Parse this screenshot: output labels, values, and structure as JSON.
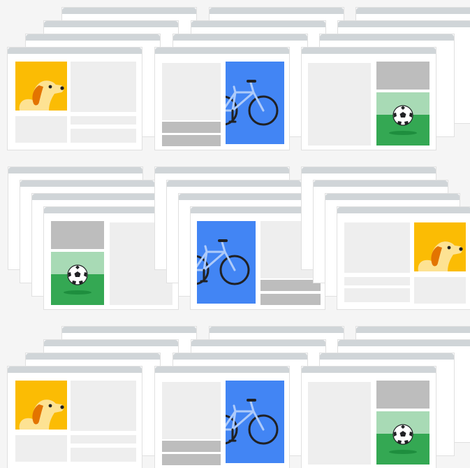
{
  "colors": {
    "background": "#f5f5f5",
    "window": "#ffffff",
    "window_border": "#e0e0e0",
    "title_bar": "#d0d5d8",
    "placeholder_light": "#eeeeee",
    "placeholder_dark": "#bdbdbd",
    "dog_tile": "#fbbc04",
    "bike_tile": "#4285f4",
    "soccer_sky": "#a8dab5",
    "soccer_grass": "#34a853"
  },
  "icons": {
    "dog": "dog-icon",
    "bicycle": "bicycle-icon",
    "soccer_ball": "soccer-ball-icon"
  },
  "grid": {
    "rows": [
      {
        "row": 1,
        "cards": [
          "dog",
          "bicycle",
          "soccer"
        ]
      },
      {
        "row": 2,
        "cards": [
          "soccer",
          "bicycle",
          "dog"
        ]
      },
      {
        "row": 3,
        "cards": [
          "dog",
          "bicycle",
          "soccer"
        ]
      }
    ]
  }
}
